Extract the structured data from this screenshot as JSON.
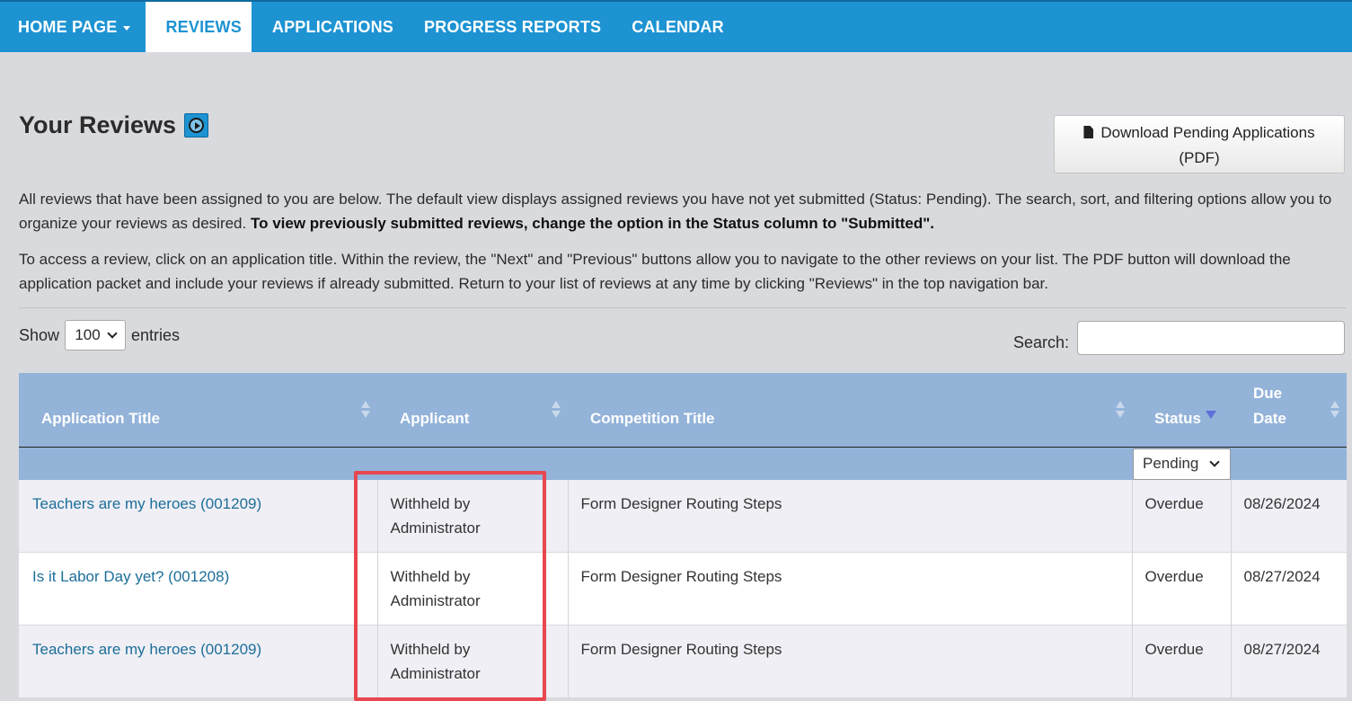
{
  "nav": {
    "home": "HOME PAGE",
    "reviews": "REVIEWS",
    "applications": "APPLICATIONS",
    "progress_reports": "PROGRESS REPORTS",
    "calendar": "CALENDAR"
  },
  "page": {
    "title": "Your Reviews",
    "download_line1": "Download Pending Applications",
    "download_line2": "(PDF)",
    "intro1_normal": "All reviews that have been assigned to you are below. The default view displays assigned reviews you have not yet submitted (Status: Pending). The search, sort, and filtering options allow you to organize your reviews as desired. ",
    "intro1_bold": "To view previously submitted reviews, change the option in the Status column to \"Submitted\".",
    "intro2": "To access a review, click on an application title. Within the review, the \"Next\" and \"Previous\" buttons allow you to navigate to the other reviews on your list. The PDF button will download the application packet and include your reviews if already submitted. Return to your list of reviews at any time by clicking \"Reviews\" in the top navigation bar."
  },
  "controls": {
    "show_label": "Show",
    "show_value": "100",
    "entries_label": "entries",
    "search_label": "Search:",
    "search_value": "",
    "status_filter": "Pending"
  },
  "table": {
    "headers": {
      "application_title": "Application Title",
      "applicant": "Applicant",
      "competition_title": "Competition Title",
      "status": "Status",
      "due_date_line1": "Due",
      "due_date_line2": "Date"
    },
    "rows": [
      {
        "title": "Teachers are my heroes (001209)",
        "applicant_line1": "Withheld by",
        "applicant_line2": "Administrator",
        "competition": "Form Designer Routing Steps",
        "status": "Overdue",
        "due": "08/26/2024"
      },
      {
        "title": "Is it Labor Day yet? (001208)",
        "applicant_line1": "Withheld by",
        "applicant_line2": "Administrator",
        "competition": "Form Designer Routing Steps",
        "status": "Overdue",
        "due": "08/27/2024"
      },
      {
        "title": "Teachers are my heroes (001209)",
        "applicant_line1": "Withheld by",
        "applicant_line2": "Administrator",
        "competition": "Form Designer Routing Steps",
        "status": "Overdue",
        "due": "08/27/2024"
      }
    ]
  },
  "colors": {
    "nav_bg": "#1d93d2",
    "table_header_bg": "#93b3d9",
    "link": "#1d6e99",
    "highlight": "#e8474f"
  }
}
